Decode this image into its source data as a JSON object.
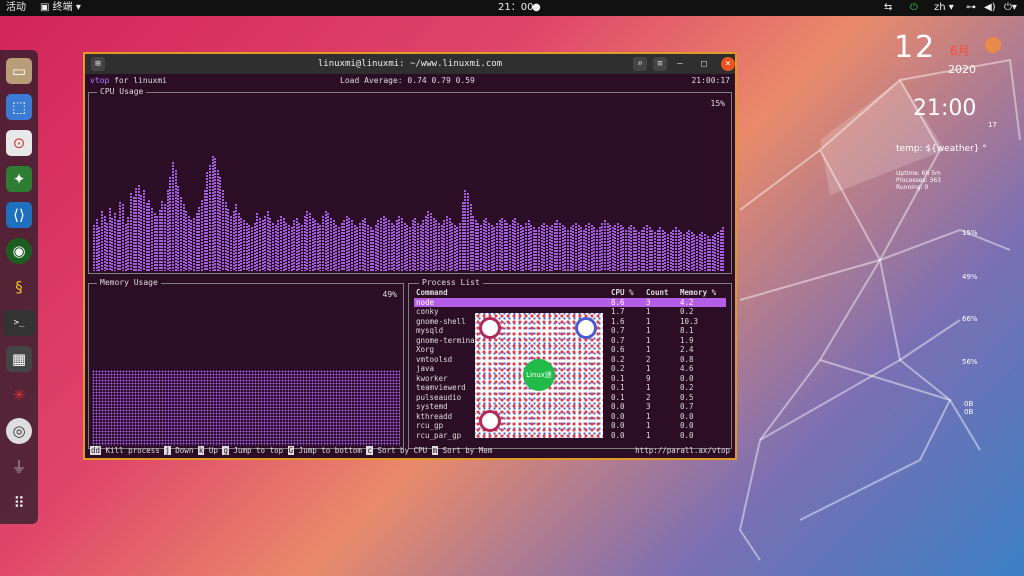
{
  "topbar": {
    "activities": "活动",
    "app_menu": "终端 ▾",
    "clock": "21：00",
    "lang": "zh ▾"
  },
  "dock": {
    "items": [
      {
        "name": "files-icon",
        "glyph": "🗀"
      },
      {
        "name": "screenshot-icon",
        "glyph": "⬚"
      },
      {
        "name": "toggle-settings-icon",
        "glyph": "⚙"
      },
      {
        "name": "android-studio-icon",
        "glyph": "⚙"
      },
      {
        "name": "vscode-icon",
        "glyph": "⌨"
      },
      {
        "name": "globe-icon",
        "glyph": "◉"
      },
      {
        "name": "python-icon",
        "glyph": "🐍"
      },
      {
        "name": "terminal-icon",
        "glyph": ">_"
      },
      {
        "name": "calculator-icon",
        "glyph": "▦"
      },
      {
        "name": "spider-icon",
        "glyph": "✳"
      },
      {
        "name": "dvd-icon",
        "glyph": "◎"
      },
      {
        "name": "usb-icon",
        "glyph": "⏚"
      },
      {
        "name": "app-grid-icon",
        "glyph": "⠿"
      }
    ]
  },
  "conky": {
    "day": "12",
    "month_label": "6月",
    "year": "2020",
    "time": "21:00",
    "seconds": "17",
    "temp": "temp: ${weather} °",
    "uptime": "Uptime: 6h 5m",
    "processes": "Processes: 363",
    "running": "Running: 0",
    "cpu_pct": "15%",
    "mem_pct": "49%",
    "disk_pct": "66%",
    "swap_pct": "56%",
    "net_a": "0B",
    "net_b": "0B"
  },
  "terminal": {
    "title": "linuxmi@linuxmi: ~/www.linuxmi.com",
    "app_name": "vtop",
    "app_suffix": " for linuxmi",
    "load_avg": "Load Average: 0.74 0.79 0.59",
    "time": "21:00:17",
    "cpu_title": "CPU Usage",
    "cpu_pct": "15%",
    "mem_title": "Memory Usage",
    "mem_pct": "49%",
    "proc_title": "Process List",
    "headers": {
      "command": "Command",
      "cpu": "CPU %",
      "count": "Count",
      "mem": "Memory %"
    },
    "processes": [
      {
        "cmd": "node",
        "cpu": "8.6",
        "count": "3",
        "mem": "4.2"
      },
      {
        "cmd": "conky",
        "cpu": "1.7",
        "count": "1",
        "mem": "0.2"
      },
      {
        "cmd": "gnome-shell",
        "cpu": "1.6",
        "count": "1",
        "mem": "10.3"
      },
      {
        "cmd": "mysqld",
        "cpu": "0.7",
        "count": "1",
        "mem": "8.1"
      },
      {
        "cmd": "gnome-terminal",
        "cpu": "0.7",
        "count": "1",
        "mem": "1.9"
      },
      {
        "cmd": "Xorg",
        "cpu": "0.6",
        "count": "1",
        "mem": "2.4"
      },
      {
        "cmd": "vmtoolsd",
        "cpu": "0.2",
        "count": "2",
        "mem": "0.8"
      },
      {
        "cmd": "java",
        "cpu": "0.2",
        "count": "1",
        "mem": "4.6"
      },
      {
        "cmd": "kworker",
        "cpu": "0.1",
        "count": "9",
        "mem": "0.0"
      },
      {
        "cmd": "teamviewerd",
        "cpu": "0.1",
        "count": "1",
        "mem": "0.2"
      },
      {
        "cmd": "pulseaudio",
        "cpu": "0.1",
        "count": "2",
        "mem": "0.5"
      },
      {
        "cmd": "systemd",
        "cpu": "0.0",
        "count": "3",
        "mem": "0.7"
      },
      {
        "cmd": "kthreadd",
        "cpu": "0.0",
        "count": "1",
        "mem": "0.0"
      },
      {
        "cmd": "rcu_gp",
        "cpu": "0.0",
        "count": "1",
        "mem": "0.0"
      },
      {
        "cmd": "rcu_par_gp",
        "cpu": "0.0",
        "count": "1",
        "mem": "0.0"
      }
    ],
    "footer": {
      "k1": "dd",
      "l1": " Kill process ",
      "k2": "j",
      "l2": " Down ",
      "k3": "k",
      "l3": " Up ",
      "k4": "g",
      "l4": " Jump to top ",
      "k5": "G",
      "l5": " Jump to bottom ",
      "k6": "c",
      "l6": " Sort by CPU ",
      "k7": "m",
      "l7": " Sort by Mem",
      "url": "http://parall.ax/vtop"
    },
    "qr_label": "Linux迷",
    "cpu_history": [
      40,
      45,
      38,
      52,
      48,
      42,
      55,
      46,
      50,
      44,
      60,
      58,
      41,
      47,
      68,
      64,
      72,
      75,
      66,
      70,
      59,
      62,
      55,
      50,
      48,
      53,
      61,
      58,
      70,
      82,
      95,
      88,
      74,
      64,
      58,
      52,
      48,
      44,
      46,
      50,
      56,
      62,
      70,
      86,
      92,
      100,
      98,
      88,
      82,
      70,
      60,
      54,
      48,
      52,
      58,
      50,
      46,
      44,
      42,
      40,
      38,
      42,
      50,
      46,
      44,
      48,
      52,
      46,
      42,
      40,
      44,
      48,
      46,
      42,
      40,
      38,
      44,
      46,
      42,
      40,
      48,
      52,
      50,
      46,
      44,
      42,
      40,
      48,
      52,
      50,
      46,
      44,
      40,
      38,
      42,
      44,
      48,
      46,
      44,
      40,
      38,
      42,
      44,
      46,
      40,
      38,
      36,
      40,
      44,
      46,
      48,
      46,
      44,
      42,
      40,
      44,
      48,
      46,
      42,
      40,
      38,
      44,
      46,
      42,
      40,
      44,
      48,
      52,
      50,
      46,
      44,
      42,
      40,
      44,
      48,
      46,
      42,
      40,
      38,
      42,
      60,
      70,
      68,
      58,
      48,
      44,
      42,
      40,
      44,
      46,
      42,
      40,
      38,
      42,
      44,
      46,
      44,
      42,
      40,
      44,
      46,
      42,
      40,
      38,
      42,
      44,
      40,
      38,
      36,
      38,
      40,
      42,
      40,
      38,
      40,
      42,
      44,
      42,
      40,
      38,
      36,
      38,
      40,
      42,
      40,
      38,
      36,
      40,
      42,
      40,
      38,
      36,
      38,
      42,
      44,
      42,
      40,
      38,
      40,
      42,
      40,
      38,
      36,
      38,
      40,
      38,
      36,
      34,
      36,
      38,
      40,
      38,
      36,
      34,
      36,
      38,
      36,
      34,
      32,
      34,
      36,
      38,
      36,
      34,
      32,
      34,
      36,
      34,
      32,
      30,
      32,
      34,
      32,
      30,
      28,
      30,
      32,
      34,
      36,
      38
    ]
  }
}
